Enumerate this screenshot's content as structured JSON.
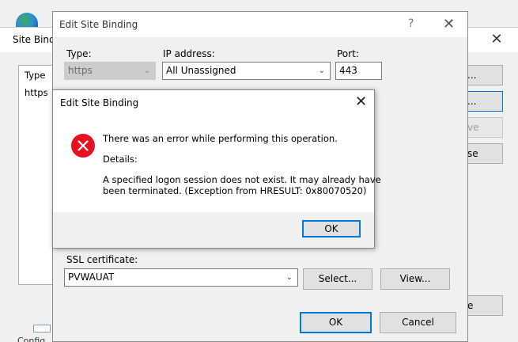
{
  "site_bindings": {
    "title": "Site Bindi",
    "list_header": "Type",
    "list_row": "https",
    "buttons": [
      {
        "label": "...",
        "state": "normal"
      },
      {
        "label": "...",
        "state": "focused"
      },
      {
        "label": "ve",
        "state": "disabled"
      },
      {
        "label": "se",
        "state": "normal"
      },
      {
        "label": "e",
        "state": "normal"
      }
    ],
    "bottom_text": "Config"
  },
  "edit_binding": {
    "title": "Edit Site Binding",
    "help_glyph": "?",
    "type_label": "Type:",
    "type_value": "https",
    "ip_label": "IP address:",
    "ip_value": "All Unassigned",
    "port_label": "Port:",
    "port_value": "443",
    "ssl_label": "SSL certificate:",
    "ssl_value": "PVWAUAT",
    "select_button": "Select...",
    "view_button": "View...",
    "ok_button": "OK",
    "cancel_button": "Cancel"
  },
  "error_dialog": {
    "title": "Edit Site Binding",
    "message": "There was an error while performing this operation.",
    "details_label": "Details:",
    "details_line1": "A specified logon session does not exist. It may already have",
    "details_line2": "been terminated. (Exception from HRESULT: 0x80070520)",
    "ok_button": "OK",
    "icon": "error-icon",
    "icon_color": "#e81123"
  },
  "colors": {
    "accent": "#0078d7",
    "dialog_bg": "#f0f0f0"
  }
}
